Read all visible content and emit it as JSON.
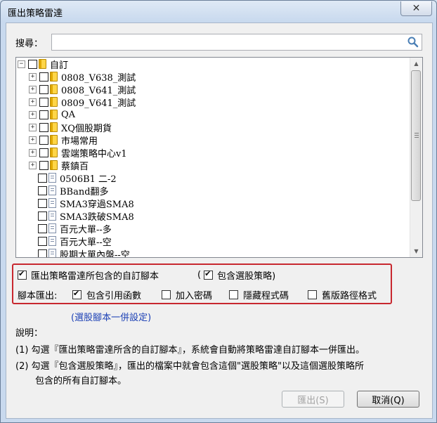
{
  "window": {
    "title": "匯出策略雷達",
    "close_glyph": "✕"
  },
  "search": {
    "label": "搜尋：",
    "value": "",
    "placeholder": ""
  },
  "tree": {
    "root": {
      "label": "自訂",
      "expander": "⊟"
    },
    "items": [
      {
        "label": "0808_V638_測試",
        "type": "folder"
      },
      {
        "label": "0808_V641_測試",
        "type": "folder"
      },
      {
        "label": "0809_V641_測試",
        "type": "folder"
      },
      {
        "label": "QA",
        "type": "folder"
      },
      {
        "label": "XQ個股期貨",
        "type": "folder"
      },
      {
        "label": "市場常用",
        "type": "folder"
      },
      {
        "label": "雲端策略中心v1",
        "type": "folder"
      },
      {
        "label": "蔡鎮百",
        "type": "folder"
      },
      {
        "label": "0506B1 二-2",
        "type": "script"
      },
      {
        "label": "BBand翻多",
        "type": "script"
      },
      {
        "label": "SMA3穿過SMA8",
        "type": "script"
      },
      {
        "label": "SMA3跌破SMA8",
        "type": "script"
      },
      {
        "label": "百元大單--多",
        "type": "script"
      },
      {
        "label": "百元大單--空",
        "type": "script"
      },
      {
        "label": "股期大單內盤--空",
        "type": "script"
      }
    ]
  },
  "options": {
    "export_custom_scripts": {
      "label": "匯出策略雷達所包含的自訂腳本",
      "checked": true
    },
    "include_stock_strategy": {
      "label": "包含選股策略)",
      "prefix": "(",
      "checked": true
    },
    "script_export_label": "腳本匯出:",
    "include_ref_functions": {
      "label": "包含引用函數",
      "checked": true
    },
    "add_password": {
      "label": "加入密碼",
      "checked": false
    },
    "hide_code": {
      "label": "隱藏程式碼",
      "checked": false
    },
    "old_path_format": {
      "label": "舊版路徑格式",
      "checked": false
    }
  },
  "link": {
    "label": "(選股腳本一併設定)"
  },
  "description": {
    "title": "說明：",
    "lines": [
      "(1) 勾選『匯出策略雷達所含的自訂腳本』，系統會自動將策略雷達自訂腳本一併匯出。",
      "(2) 勾選『包含選股策略』，匯出的檔案中就會包含這個\"選股策略\"以及這個選股策略所",
      "包含的所有自訂腳本。"
    ]
  },
  "buttons": {
    "export": "匯出(S)",
    "cancel": "取消(Q)"
  }
}
